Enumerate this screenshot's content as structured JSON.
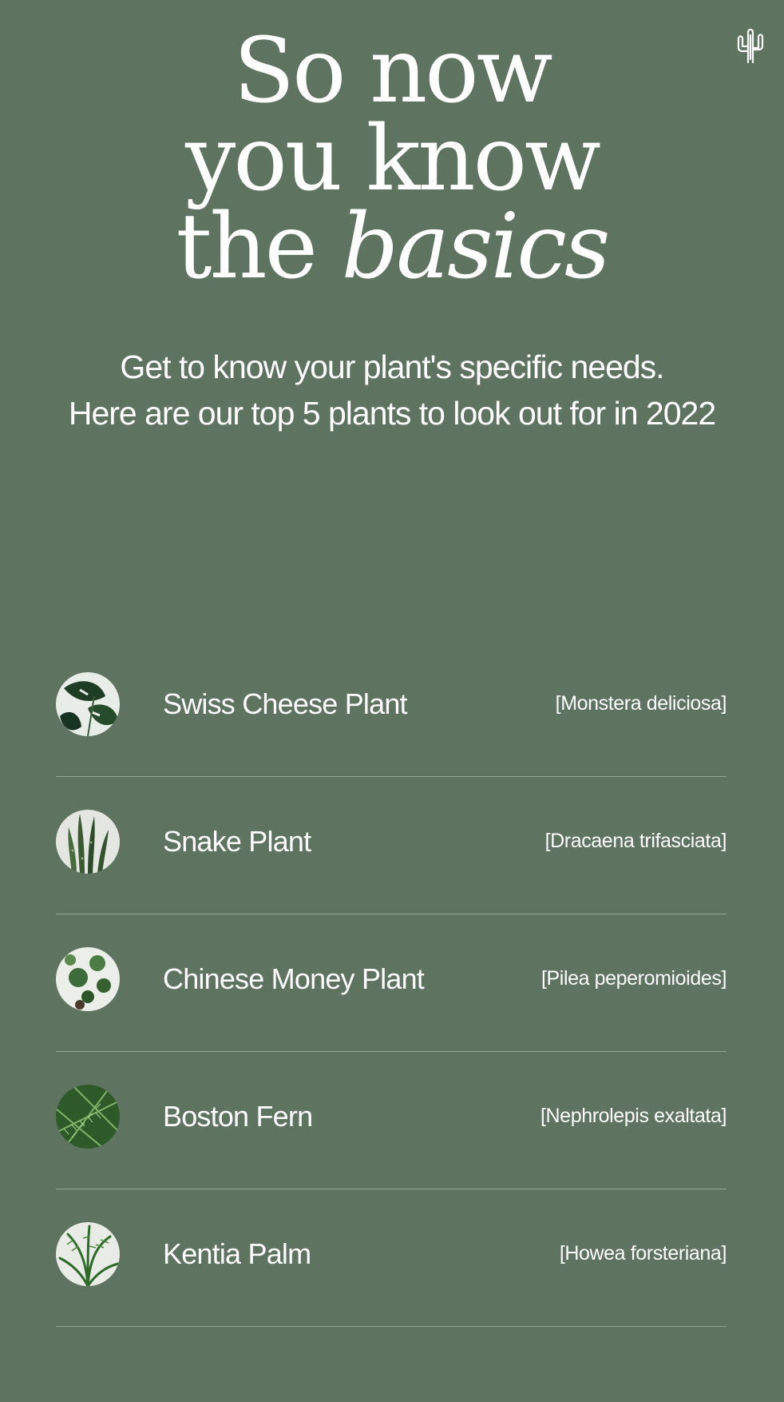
{
  "brand": {
    "logo_icon": "cactus-icon"
  },
  "hero": {
    "line1": "So now",
    "line2": "you know",
    "line3_plain": "the",
    "line3_italic": "basics"
  },
  "intro": {
    "line1": "Get to know your plant's specific needs.",
    "line2": "Here are our top 5 plants to look out for in 2022"
  },
  "plants": [
    {
      "name": "Swiss Cheese Plant",
      "latin": "[Monstera deliciosa]",
      "icon": "monstera-thumbnail"
    },
    {
      "name": "Snake Plant",
      "latin": "[Dracaena trifasciata]",
      "icon": "snake-plant-thumbnail"
    },
    {
      "name": "Chinese Money Plant",
      "latin": "[Pilea peperomioides]",
      "icon": "pilea-thumbnail"
    },
    {
      "name": "Boston Fern",
      "latin": "[Nephrolepis exaltata]",
      "icon": "fern-thumbnail"
    },
    {
      "name": "Kentia Palm",
      "latin": "[Howea forsteriana]",
      "icon": "palm-thumbnail"
    }
  ],
  "colors": {
    "background": "#5f7361",
    "text": "#ffffff"
  }
}
